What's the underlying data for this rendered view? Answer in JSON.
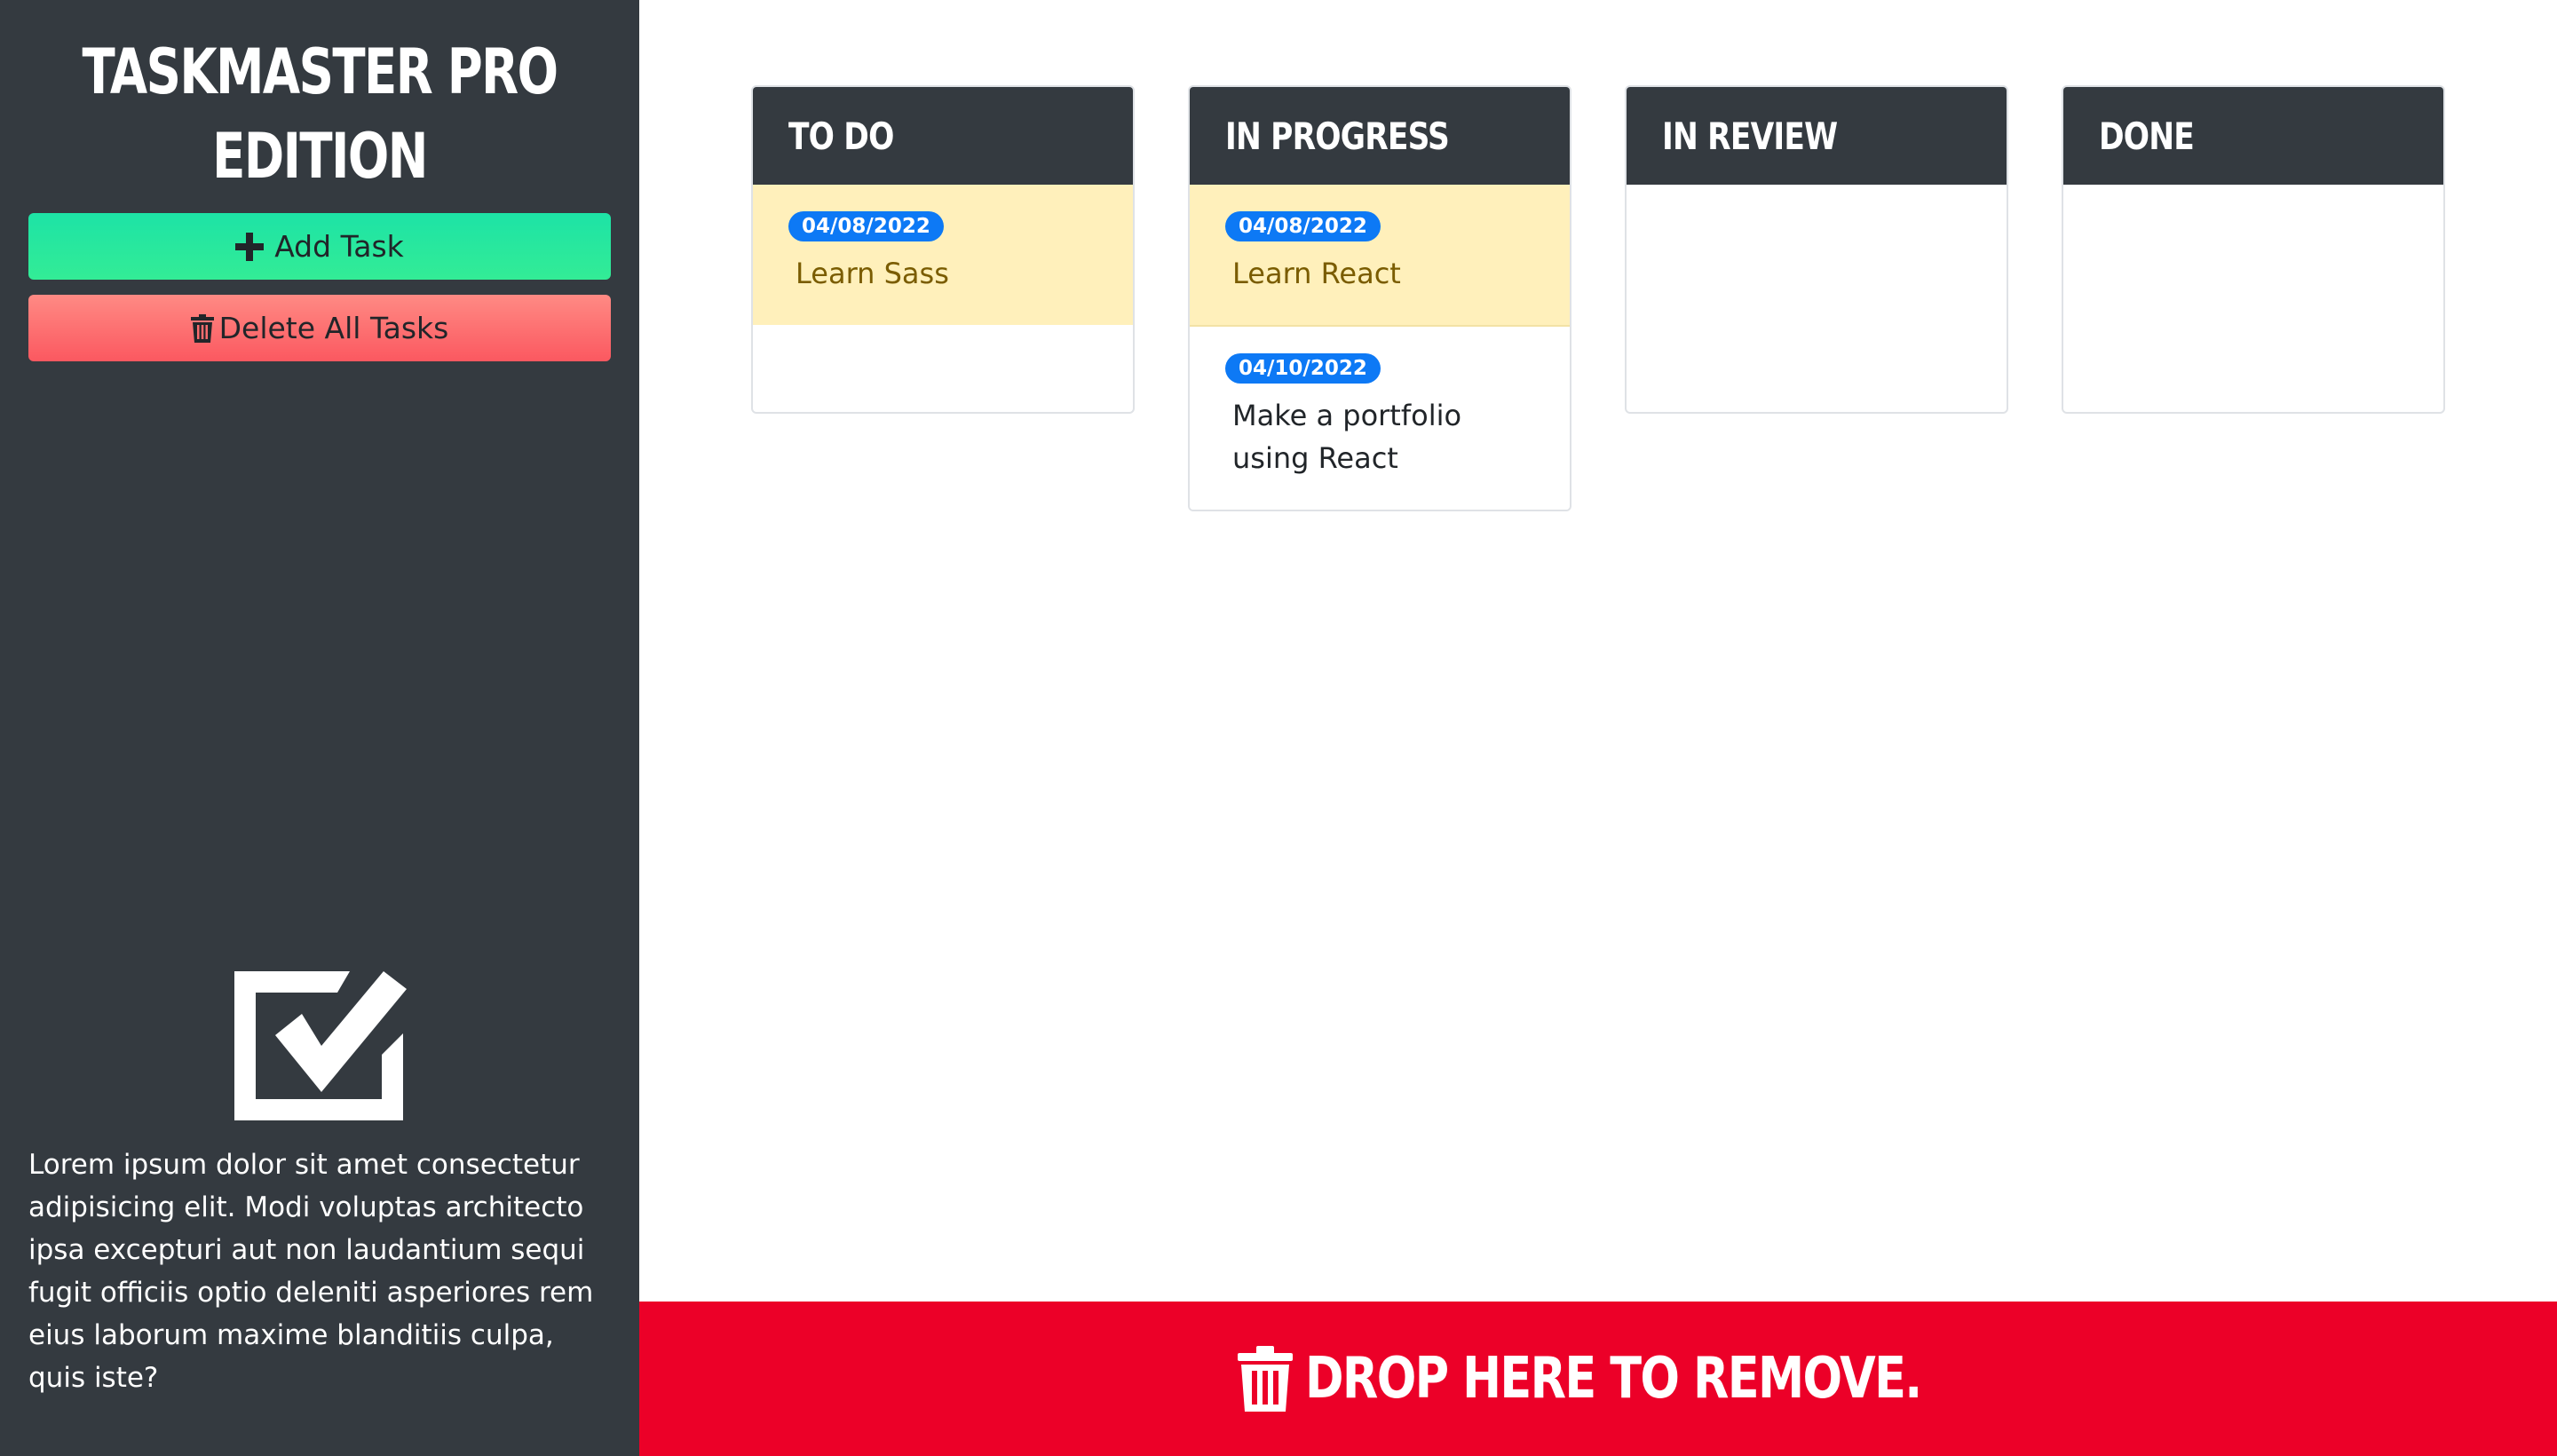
{
  "app": {
    "title": "TASKMASTER PRO EDITION"
  },
  "sidebar": {
    "add_label": "Add Task",
    "delete_label": "Delete All Tasks",
    "logo_icon": "checkbox-checked-icon",
    "description": "Lorem ipsum dolor sit amet consectetur adipisicing elit. Modi voluptas architecto ipsa excepturi aut non laudantium sequi fugit officiis optio deleniti asperiores rem eius laborum maxime blanditiis culpa, quis iste?"
  },
  "columns": [
    {
      "title": "TO DO",
      "tasks": [
        {
          "date": "04/08/2022",
          "text": "Learn Sass",
          "status": "warning"
        }
      ]
    },
    {
      "title": "IN PROGRESS",
      "tasks": [
        {
          "date": "04/08/2022",
          "text": "Learn React",
          "status": "warning"
        },
        {
          "date": "04/10/2022",
          "text": "Make a portfolio using React",
          "status": "normal"
        }
      ]
    },
    {
      "title": "IN REVIEW",
      "tasks": []
    },
    {
      "title": "DONE",
      "tasks": []
    }
  ],
  "dropzone": {
    "label": "DROP HERE TO REMOVE.",
    "icon": "trash-icon"
  },
  "colors": {
    "sidebar_bg": "#343a40",
    "add_button": "#2be89d",
    "delete_button": "#fc6d6f",
    "badge": "#0d79f5",
    "task_warning_bg": "#fff0bb",
    "dropzone_bg": "#ec0028"
  }
}
